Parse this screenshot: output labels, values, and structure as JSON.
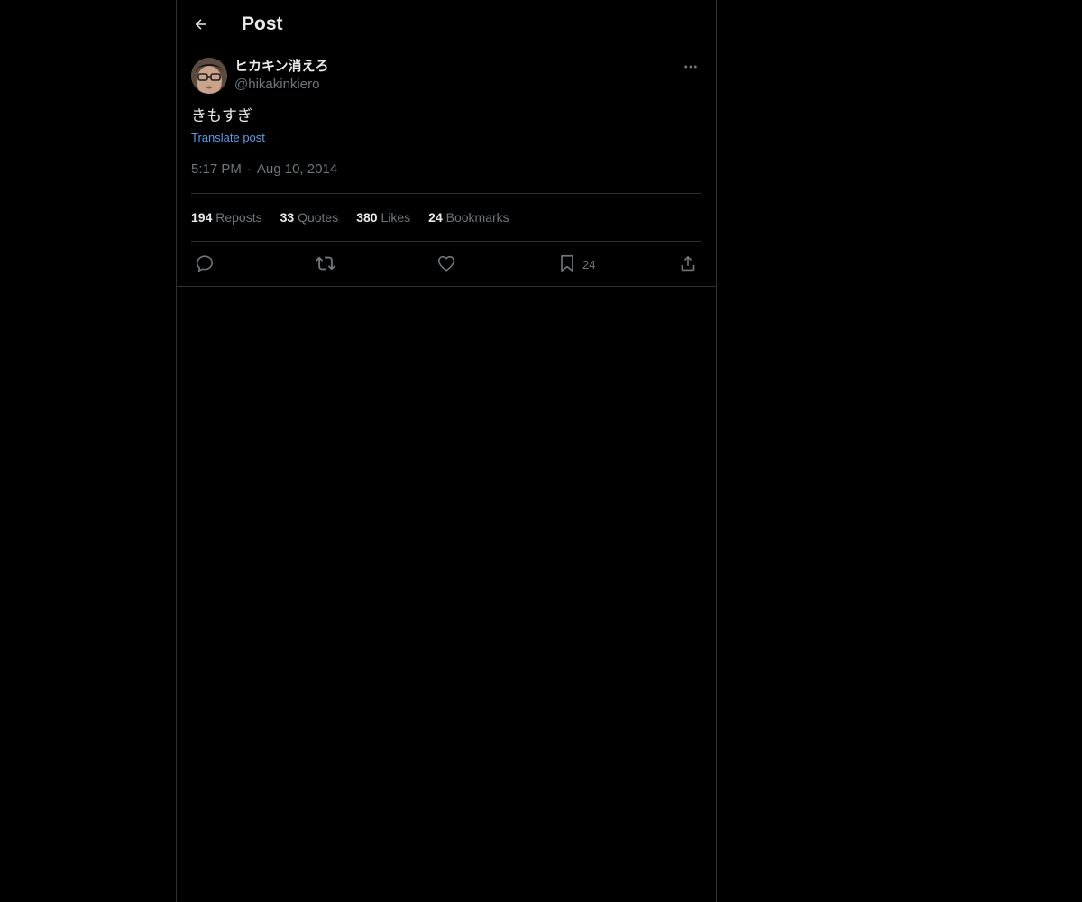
{
  "header": {
    "back_icon": "arrow-left-icon",
    "title": "Post"
  },
  "post": {
    "author": {
      "display_name": "ヒカキン消えろ",
      "handle": "@hikakinkiero",
      "avatar_icon": "user-avatar"
    },
    "more_icon": "more-horizontal-icon",
    "text": "きもすぎ",
    "translate_label": "Translate post",
    "time": "5:17 PM",
    "separator": "·",
    "date": "Aug 10, 2014",
    "stats": {
      "reposts_count": "194",
      "reposts_label": "Reposts",
      "quotes_count": "33",
      "quotes_label": "Quotes",
      "likes_count": "380",
      "likes_label": "Likes",
      "bookmarks_count": "24",
      "bookmarks_label": "Bookmarks"
    },
    "actions": {
      "reply_icon": "reply-icon",
      "repost_icon": "repost-icon",
      "like_icon": "heart-icon",
      "bookmark_icon": "bookmark-icon",
      "bookmark_count": "24",
      "share_icon": "share-icon"
    }
  },
  "colors": {
    "background": "#000000",
    "text_primary": "#e7e9ea",
    "text_secondary": "#71767b",
    "link": "#5b9ce8",
    "border": "#2f3336"
  }
}
